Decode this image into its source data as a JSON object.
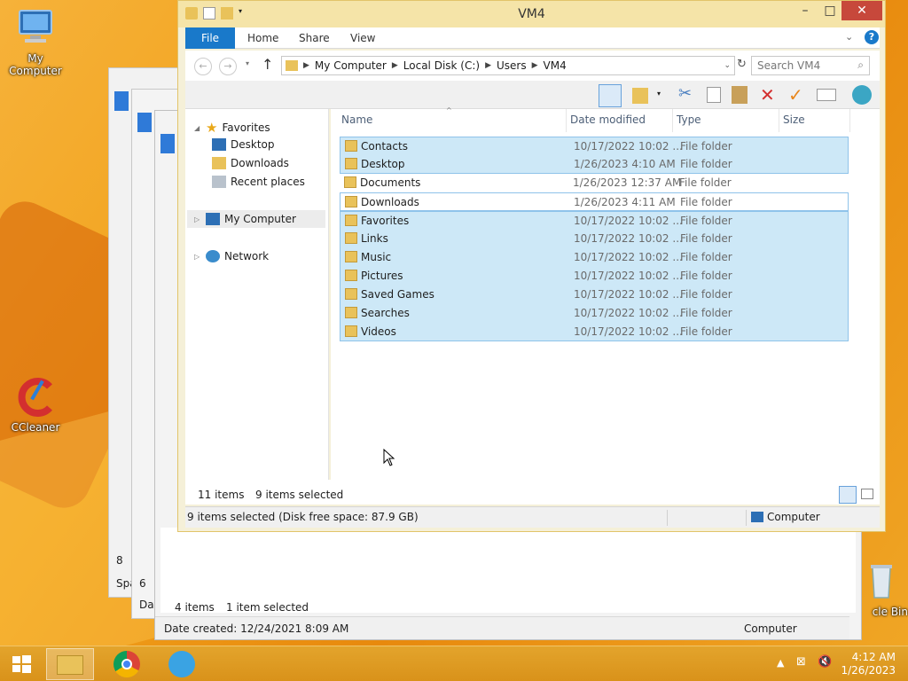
{
  "desktop": {
    "icons": {
      "my_computer": "My Computer",
      "ccleaner": "CCleaner",
      "recycle_bin": "cle Bin"
    }
  },
  "background_window": {
    "left_label_a": "8",
    "left_label_b": "Spa",
    "left_label_c": "6",
    "left_label_d": "Dat",
    "items_count": "4 items",
    "selected": "1 item selected",
    "status": "Date created: 12/24/2021 8:09 AM",
    "location": "Computer"
  },
  "window": {
    "title": "VM4",
    "ribbon_tabs": [
      "File",
      "Home",
      "Share",
      "View"
    ],
    "breadcrumb": [
      "My Computer",
      "Local Disk (C:)",
      "Users",
      "VM4"
    ],
    "search_placeholder": "Search VM4",
    "nav": {
      "favorites": "Favorites",
      "desktop": "Desktop",
      "downloads": "Downloads",
      "recent": "Recent places",
      "my_computer": "My Computer",
      "network": "Network"
    },
    "columns": [
      "Name",
      "Date modified",
      "Type",
      "Size"
    ],
    "files": [
      {
        "name": "Contacts",
        "date": "10/17/2022 10:02 ...",
        "type": "File folder",
        "selected": true
      },
      {
        "name": "Desktop",
        "date": "1/26/2023 4:10 AM",
        "type": "File folder",
        "selected": true
      },
      {
        "name": "Documents",
        "date": "1/26/2023 12:37 AM",
        "type": "File folder",
        "selected": false
      },
      {
        "name": "Downloads",
        "date": "1/26/2023 4:11 AM",
        "type": "File folder",
        "selected": false
      },
      {
        "name": "Favorites",
        "date": "10/17/2022 10:02 ...",
        "type": "File folder",
        "selected": true
      },
      {
        "name": "Links",
        "date": "10/17/2022 10:02 ...",
        "type": "File folder",
        "selected": true
      },
      {
        "name": "Music",
        "date": "10/17/2022 10:02 ...",
        "type": "File folder",
        "selected": true
      },
      {
        "name": "Pictures",
        "date": "10/17/2022 10:02 ...",
        "type": "File folder",
        "selected": true
      },
      {
        "name": "Saved Games",
        "date": "10/17/2022 10:02 ...",
        "type": "File folder",
        "selected": true
      },
      {
        "name": "Searches",
        "date": "10/17/2022 10:02 ...",
        "type": "File folder",
        "selected": true
      },
      {
        "name": "Videos",
        "date": "10/17/2022 10:02 ...",
        "type": "File folder",
        "selected": true
      }
    ],
    "item_count": "11 items",
    "selected_count": "9 items selected",
    "status_text": "9 items selected (Disk free space: 87.9 GB)",
    "status_location": "Computer"
  },
  "taskbar": {
    "time": "4:12 AM",
    "date": "1/26/2023"
  },
  "colors": {
    "accent": "#1979ca",
    "selection": "#cde8f7",
    "title_bar": "#f5e4a8"
  }
}
